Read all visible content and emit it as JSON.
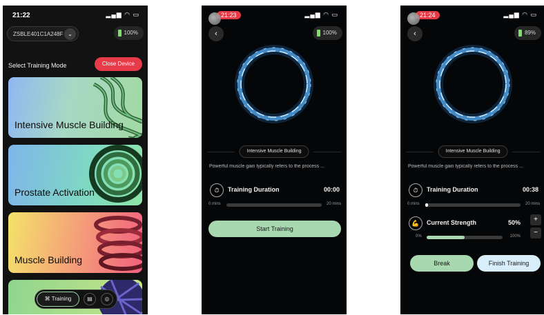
{
  "screen1": {
    "status_time": "21:22",
    "device_id": "ZSBLE401C1A248F",
    "battery": "100%",
    "section_title": "Select Training Mode",
    "close_button": "Close Device",
    "cards": [
      {
        "label": "Intensive Muscle Building"
      },
      {
        "label": "Prostate Activation"
      },
      {
        "label": "Muscle Building"
      },
      {
        "label": ""
      }
    ],
    "tabbar": {
      "active_tab": "Training",
      "icons": [
        "training-icon",
        "calendar-icon",
        "settings-icon"
      ]
    }
  },
  "screen2": {
    "status_time": "21:23",
    "battery": "100%",
    "mode": "Intensive Muscle Building",
    "description": "Powerful muscle gain typically refers to the process ...",
    "duration_label": "Training Duration",
    "duration_value": "00:00",
    "duration_min": "0 mins",
    "duration_max": "20 mins",
    "duration_progress": 0,
    "start_button": "Start Training"
  },
  "screen3": {
    "status_time": "21:24",
    "battery": "89%",
    "mode": "Intensive Muscle Building",
    "description": "Powerful muscle gain typically refers to the process ...",
    "duration_label": "Training Duration",
    "duration_value": "00:38",
    "duration_min": "0 mins",
    "duration_max": "20 mins",
    "duration_progress": 0.03,
    "strength_label": "Current Strength",
    "strength_value": "50%",
    "strength_min": "0%",
    "strength_max": "100%",
    "strength_progress": 0.5,
    "plus": "+",
    "minus": "−",
    "break_button": "Break",
    "finish_button": "Finish Training"
  },
  "colors": {
    "accent_red": "#e83b4a",
    "accent_green": "#a8d8b0",
    "orb_glow": "#7ec8ff"
  }
}
